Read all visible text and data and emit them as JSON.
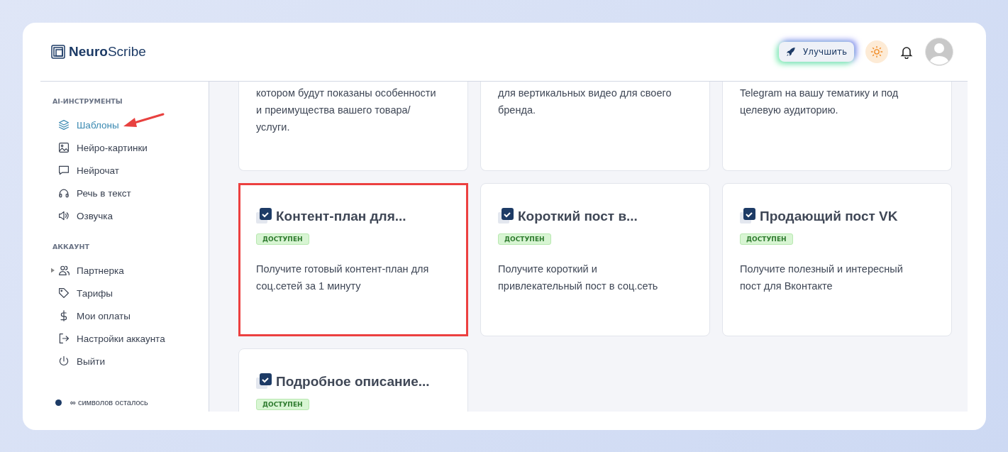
{
  "logo": {
    "bold": "Neuro",
    "rest": "Scribe"
  },
  "header": {
    "upgrade_button": "Улучшить"
  },
  "sidebar": {
    "sections": [
      {
        "title": "AI-ИНСТРУМЕНТЫ",
        "items": [
          {
            "label": "Шаблоны",
            "selected": true,
            "pointed": true
          },
          {
            "label": "Нейро-картинки",
            "selected": false,
            "pointed": false
          },
          {
            "label": "Нейрочат",
            "selected": false,
            "pointed": false
          },
          {
            "label": "Речь в текст",
            "selected": false,
            "pointed": false
          },
          {
            "label": "Озвучка",
            "selected": false,
            "pointed": false
          }
        ]
      },
      {
        "title": "АККАУНТ",
        "items": [
          {
            "label": "Партнерка",
            "selected": false,
            "expandable": true
          },
          {
            "label": "Тарифы",
            "selected": false
          },
          {
            "label": "Мои оплаты",
            "selected": false
          },
          {
            "label": "Настройки аккаунта",
            "selected": false
          },
          {
            "label": "Выйти",
            "selected": false
          }
        ]
      }
    ],
    "footer": {
      "symbol": "∞",
      "text": "символов осталось"
    }
  },
  "cards": [
    {
      "kind": "partial",
      "description": "котором будут показаны особенности и преимущества вашего товара/услуги.",
      "highlighted": false
    },
    {
      "kind": "partial",
      "description": "для вертикальных видео для своего бренда.",
      "highlighted": false
    },
    {
      "kind": "partial",
      "description": "Telegram на вашу тематику и под целевую аудиторию.",
      "highlighted": false
    },
    {
      "kind": "full",
      "title": "Контент-план для...",
      "badge": "ДОСТУПЕН",
      "description": "Получите готовый контент-план для соц.сетей за 1 минуту",
      "highlighted": true
    },
    {
      "kind": "full",
      "title": "Короткий пост в...",
      "badge": "ДОСТУПЕН",
      "description": "Получите короткий и привлекательный пост в соц.сеть",
      "highlighted": false
    },
    {
      "kind": "full",
      "title": "Продающий пост VK",
      "badge": "ДОСТУПЕН",
      "description": "Получите полезный и интересный пост для Вконтакте",
      "highlighted": false
    },
    {
      "kind": "full",
      "title": "Подробное описание...",
      "badge": "ДОСТУПЕН",
      "highlighted": false
    }
  ]
}
